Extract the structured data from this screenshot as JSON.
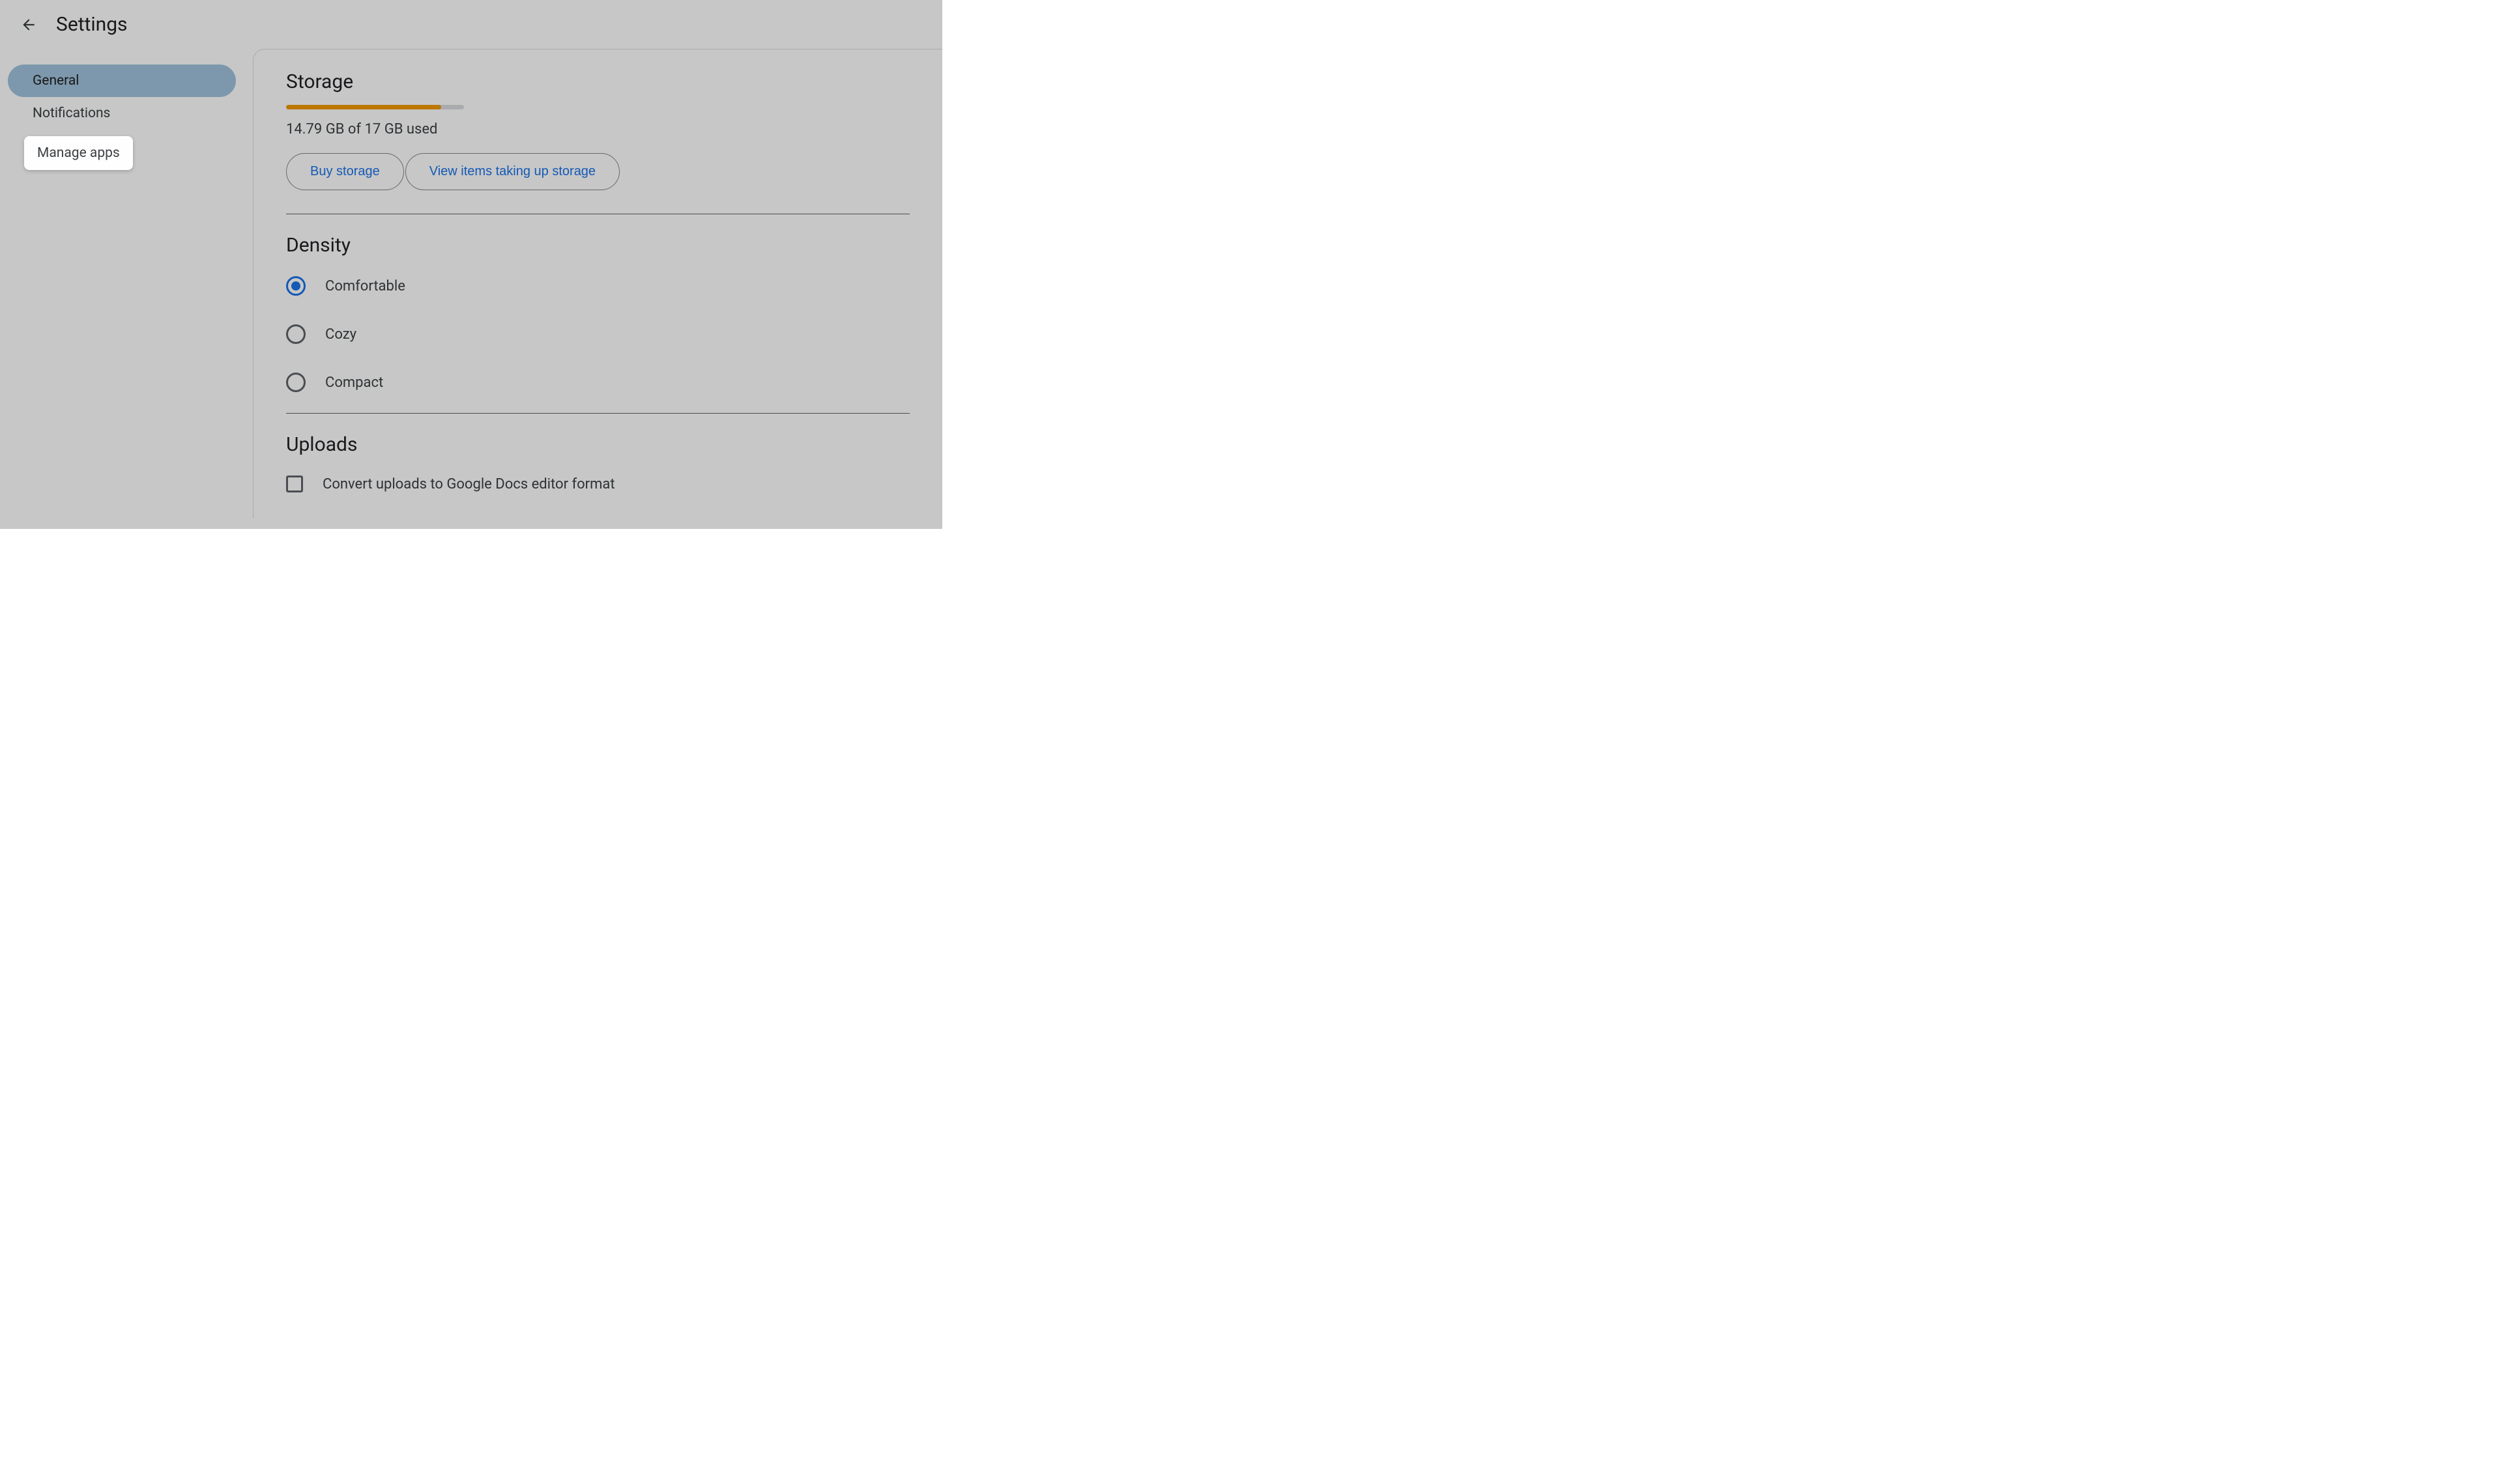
{
  "header": {
    "title": "Settings"
  },
  "sidebar": {
    "items": [
      {
        "label": "General",
        "selected": true
      },
      {
        "label": "Notifications",
        "selected": false
      },
      {
        "label": "Manage apps",
        "selected": false
      }
    ]
  },
  "tooltip": {
    "text": "Manage apps"
  },
  "storage": {
    "title": "Storage",
    "usage_text": "14.79 GB of 17 GB used",
    "percent": 87,
    "buy_button": "Buy storage",
    "view_button": "View items taking up storage"
  },
  "density": {
    "title": "Density",
    "options": [
      {
        "label": "Comfortable",
        "checked": true
      },
      {
        "label": "Cozy",
        "checked": false
      },
      {
        "label": "Compact",
        "checked": false
      }
    ]
  },
  "uploads": {
    "title": "Uploads",
    "checkbox_label": "Convert uploads to Google Docs editor format",
    "checked": false
  }
}
